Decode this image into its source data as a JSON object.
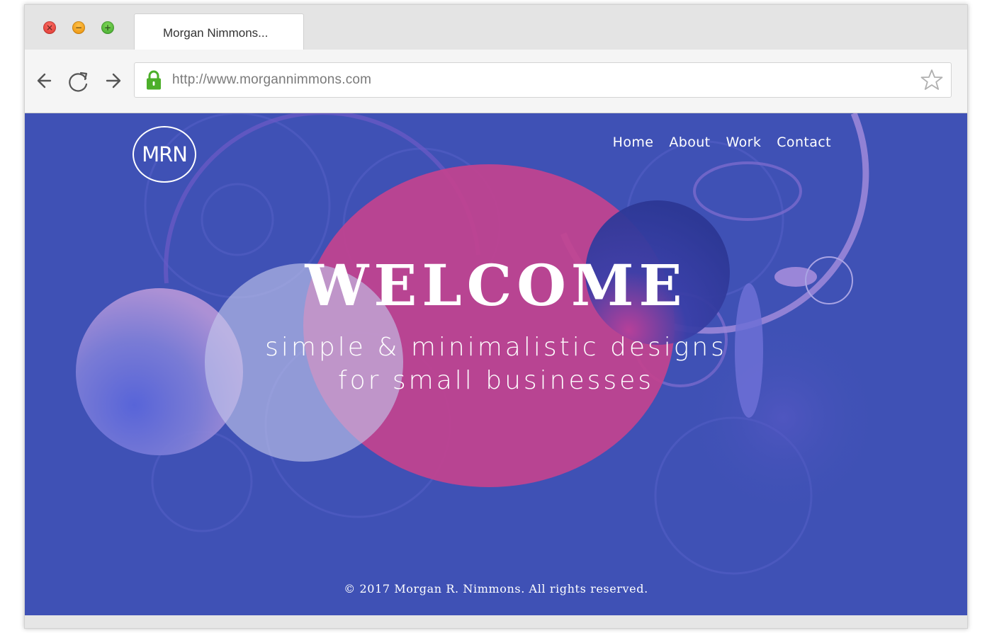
{
  "browser": {
    "tab_title": "Morgan Nimmons...",
    "url": "http://www.morgannimmons.com",
    "controls": {
      "close_glyph": "×",
      "minimize_glyph": "−",
      "maximize_glyph": "+"
    },
    "icons": [
      "back-arrow-icon",
      "reload-icon",
      "forward-arrow-icon",
      "lock-icon",
      "star-icon"
    ]
  },
  "site": {
    "logo_text": "MRN",
    "nav": [
      "Home",
      "About",
      "Work",
      "Contact"
    ],
    "hero_title": "WELCOME",
    "tagline_line1": "simple & minimalistic designs",
    "tagline_line2": "for small businesses",
    "footer": "© 2017 Morgan R. Nimmons. All rights reserved."
  },
  "colors": {
    "background": "#3f51b5",
    "accent_pink": "#c2438f",
    "lavender": "#a6aee0",
    "lock_green": "#4caf2a"
  }
}
